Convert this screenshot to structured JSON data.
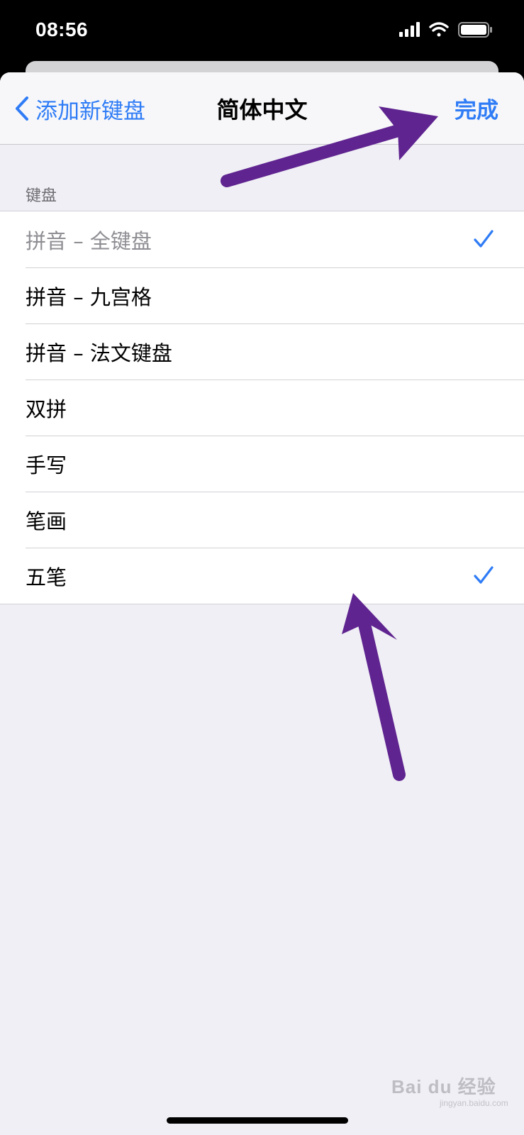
{
  "status_bar": {
    "time": "08:56",
    "icons": [
      "signal-icon",
      "wifi-icon",
      "battery-icon"
    ]
  },
  "nav": {
    "back_label": "添加新键盘",
    "title": "简体中文",
    "done_label": "完成"
  },
  "section": {
    "header": "键盘",
    "items": [
      {
        "label": "拼音 – 全键盘",
        "checked": true,
        "disabled": true
      },
      {
        "label": "拼音 – 九宫格",
        "checked": false,
        "disabled": false
      },
      {
        "label": "拼音 – 法文键盘",
        "checked": false,
        "disabled": false
      },
      {
        "label": "双拼",
        "checked": false,
        "disabled": false
      },
      {
        "label": "手写",
        "checked": false,
        "disabled": false
      },
      {
        "label": "笔画",
        "checked": false,
        "disabled": false
      },
      {
        "label": "五笔",
        "checked": true,
        "disabled": false
      }
    ]
  },
  "watermark": {
    "text": "Bai du 经验",
    "sub": "jingyan.baidu.com"
  },
  "colors": {
    "accent": "#2f7cf6",
    "annotation_arrow": "#5f2490",
    "background": "#f0eff5"
  }
}
